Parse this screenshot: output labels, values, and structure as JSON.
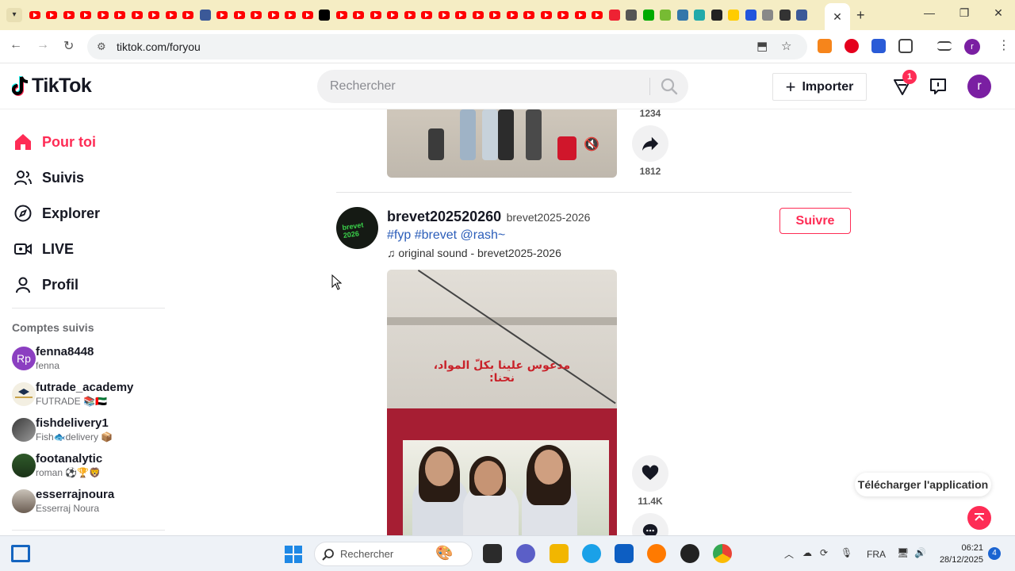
{
  "browser": {
    "url": "tiktok.com/foryou",
    "active_tab_close": "✕",
    "new_tab": "+"
  },
  "header": {
    "logo_text": "TikTok",
    "search_placeholder": "Rechercher",
    "upload_label": "Importer",
    "inbox_badge": "1",
    "avatar_letter": "r"
  },
  "sidebar": {
    "nav": [
      {
        "label": "Pour toi",
        "icon": "home-icon",
        "active": true
      },
      {
        "label": "Suivis",
        "icon": "users-icon"
      },
      {
        "label": "Explorer",
        "icon": "compass-icon"
      },
      {
        "label": "LIVE",
        "icon": "live-icon"
      },
      {
        "label": "Profil",
        "icon": "person-icon"
      }
    ],
    "section_title": "Comptes suivis",
    "accounts": [
      {
        "username": "fenna8448",
        "display": "fenna",
        "initials": "Rp"
      },
      {
        "username": "futrade_academy",
        "display": "FUTRADE 📚🇦🇪"
      },
      {
        "username": "fishdelivery1",
        "display": "Fish🐟delivery 📦"
      },
      {
        "username": "footanalytic",
        "display": "roman ⚽️🏆🦁"
      },
      {
        "username": "esserrajnoura",
        "display": "Esserraj Noura"
      }
    ]
  },
  "feed": {
    "prev_video": {
      "comment_count": "1234",
      "share_count": "1812"
    },
    "post": {
      "username": "brevet202520260",
      "nickname": "brevet2025-2026",
      "tags": "#fyp #brevet @rash~",
      "sound": "original sound - brevet2025-2026",
      "follow_label": "Suivre",
      "avatar_text": "brevet 2026",
      "overlay_text": "مدعوس علينا بكلّ المواد، نحنا:",
      "like_count": "11.4K"
    }
  },
  "floating": {
    "download_app": "Télécharger l'application"
  },
  "taskbar": {
    "search_label": "Rechercher",
    "language": "FRA",
    "time": "06:21",
    "date": "28/12/2025",
    "notifications": "4"
  },
  "colors": {
    "accent": "#fe2c55",
    "link": "#2b5db9",
    "tabstrip": "#f5edc4"
  }
}
